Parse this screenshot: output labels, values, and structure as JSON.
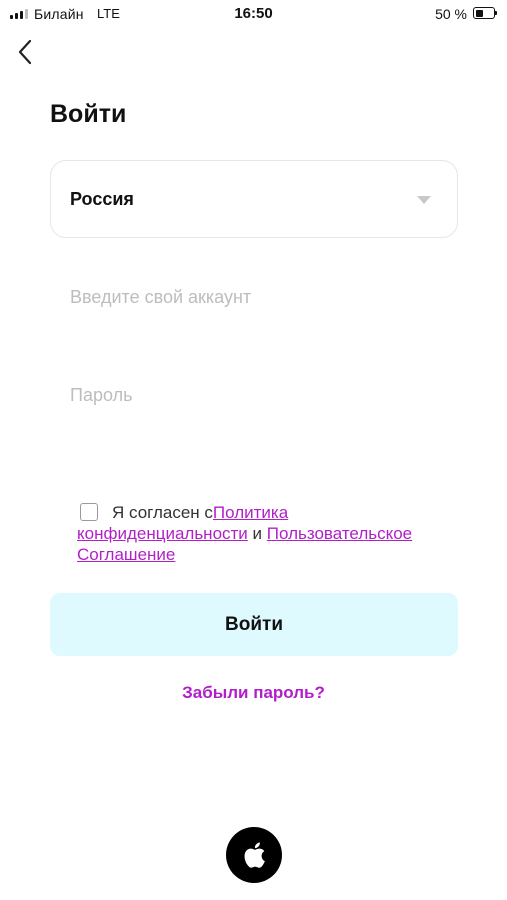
{
  "status_bar": {
    "carrier": "Билайн",
    "network": "LTE",
    "time": "16:50",
    "battery_text": "50 %",
    "battery_level": 0.5
  },
  "back": {
    "icon": "chevron-left-icon"
  },
  "title": "Войти",
  "country": {
    "value": "Россия",
    "icon": "caret-down-icon"
  },
  "fields": {
    "account_placeholder": "Введите свой аккаунт",
    "password_placeholder": "Пароль"
  },
  "agreement": {
    "checked": false,
    "prefix": "Я согласен с",
    "privacy_link": "Политика конфиденциальности",
    "conjunction": "и",
    "terms_link": "Пользовательское Соглашение"
  },
  "login_button": "Войти",
  "forgot_password": "Забыли пароль?",
  "social": {
    "icon": "apple-icon"
  },
  "colors": {
    "accent": "#b11fc9",
    "button_bg": "#defaff",
    "placeholder": "#bdbdbd"
  }
}
